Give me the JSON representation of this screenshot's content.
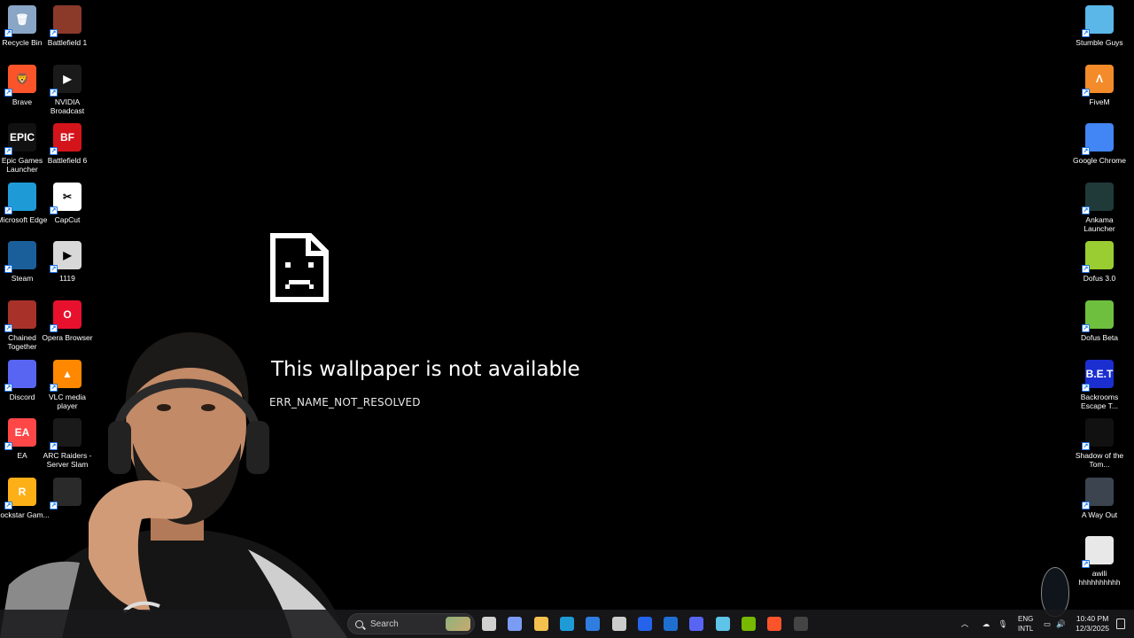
{
  "desktop_left": [
    {
      "label": "Recycle Bin",
      "icon": "recycle-bin-icon",
      "color": "#8aa6c6",
      "glyph": "🗑",
      "col": 0,
      "row": 0
    },
    {
      "label": "Battlefield 1",
      "icon": "battlefield-1-icon",
      "color": "#8b3a2a",
      "glyph": "",
      "col": 1,
      "row": 0
    },
    {
      "label": "Brave",
      "icon": "brave-icon",
      "color": "#fb542b",
      "glyph": "🦁",
      "col": 0,
      "row": 1
    },
    {
      "label": "NVIDIA Broadcast",
      "icon": "nvidia-broadcast-icon",
      "color": "#1a1a1a",
      "glyph": "▶",
      "col": 1,
      "row": 1
    },
    {
      "label": "Epic Games Launcher",
      "icon": "epic-games-icon",
      "color": "#111111",
      "glyph": "EPIC",
      "col": 0,
      "row": 2
    },
    {
      "label": "Battlefield 6",
      "icon": "battlefield-6-icon",
      "color": "#d4141b",
      "glyph": "BF",
      "col": 1,
      "row": 2
    },
    {
      "label": "Microsoft Edge",
      "icon": "edge-icon",
      "color": "#1e9bd7",
      "glyph": "",
      "col": 0,
      "row": 3
    },
    {
      "label": "CapCut",
      "icon": "capcut-icon",
      "color": "#ffffff",
      "glyph": "✂",
      "col": 1,
      "row": 3
    },
    {
      "label": "Steam",
      "icon": "steam-icon",
      "color": "#1b5f9a",
      "glyph": "",
      "col": 0,
      "row": 4
    },
    {
      "label": "1119",
      "icon": "video-file-icon",
      "color": "#d8d8d8",
      "glyph": "▶",
      "col": 1,
      "row": 4
    },
    {
      "label": "Chained Together",
      "icon": "chained-together-icon",
      "color": "#a8322a",
      "glyph": "",
      "col": 0,
      "row": 5
    },
    {
      "label": "Opera Browser",
      "icon": "opera-icon",
      "color": "#e8112d",
      "glyph": "O",
      "col": 1,
      "row": 5
    },
    {
      "label": "Discord",
      "icon": "discord-icon",
      "color": "#5865f2",
      "glyph": "",
      "col": 0,
      "row": 6
    },
    {
      "label": "VLC media player",
      "icon": "vlc-icon",
      "color": "#ff8800",
      "glyph": "▲",
      "col": 1,
      "row": 6
    },
    {
      "label": "EA",
      "icon": "ea-icon",
      "color": "#ff4747",
      "glyph": "EA",
      "col": 0,
      "row": 7
    },
    {
      "label": "ARC Raiders - Server Slam",
      "icon": "arc-raiders-icon",
      "color": "#1a1a1a",
      "glyph": "",
      "col": 1,
      "row": 7
    },
    {
      "label": "Rockstar Gam...",
      "icon": "rockstar-icon",
      "color": "#fcaf17",
      "glyph": "R",
      "col": 0,
      "row": 8
    },
    {
      "label": "",
      "icon": "obs-icon",
      "color": "#2a2a2a",
      "glyph": "",
      "col": 1,
      "row": 8
    }
  ],
  "desktop_right": [
    {
      "label": "Stumble Guys",
      "icon": "stumble-guys-icon",
      "color": "#5ab7e8",
      "glyph": "",
      "row": 0
    },
    {
      "label": "FiveM",
      "icon": "fivem-icon",
      "color": "#f38b2b",
      "glyph": "Λ",
      "row": 1
    },
    {
      "label": "Google Chrome",
      "icon": "chrome-icon",
      "color": "#4285f4",
      "glyph": "",
      "row": 2
    },
    {
      "label": "Ankama Launcher",
      "icon": "ankama-icon",
      "color": "#203a3a",
      "glyph": "",
      "row": 3
    },
    {
      "label": "Dofus 3.0",
      "icon": "dofus-icon",
      "color": "#9acd32",
      "glyph": "",
      "row": 4
    },
    {
      "label": "Dofus Beta",
      "icon": "dofus-beta-icon",
      "color": "#6fbf3f",
      "glyph": "",
      "row": 5
    },
    {
      "label": "Backrooms Escape T...",
      "icon": "backrooms-icon",
      "color": "#1b2fd1",
      "glyph": "B.E.T",
      "row": 6
    },
    {
      "label": "Shadow of the Tom...",
      "icon": "shadow-tomb-raider-icon",
      "color": "#111111",
      "glyph": "",
      "row": 7
    },
    {
      "label": "A Way Out",
      "icon": "a-way-out-icon",
      "color": "#3c4450",
      "glyph": "",
      "row": 8
    },
    {
      "label": "awili hhhhhhhhhh",
      "icon": "text-document-icon",
      "color": "#e8e8e8",
      "glyph": "",
      "row": 9
    }
  ],
  "error": {
    "title": "This wallpaper is not available",
    "code": "ERR_NAME_NOT_RESOLVED"
  },
  "taskbar": {
    "search_placeholder": "Search",
    "apps": [
      {
        "name": "task-view-icon",
        "color": "#d0d0d0"
      },
      {
        "name": "copilot-icon",
        "color": "#7b9cf5"
      },
      {
        "name": "file-explorer-icon",
        "color": "#f2c14e"
      },
      {
        "name": "edge-taskbar-icon",
        "color": "#1e9bd7"
      },
      {
        "name": "store-icon",
        "color": "#2f7de1"
      },
      {
        "name": "unity-icon",
        "color": "#cccccc"
      },
      {
        "name": "app-blue-icon",
        "color": "#2563eb"
      },
      {
        "name": "outlook-icon",
        "color": "#1f6fd1"
      },
      {
        "name": "discord-taskbar-icon",
        "color": "#5865f2"
      },
      {
        "name": "notepad-icon",
        "color": "#5ec4e8"
      },
      {
        "name": "nvidia-taskbar-icon",
        "color": "#76b900"
      },
      {
        "name": "brave-taskbar-icon",
        "color": "#fb542b"
      },
      {
        "name": "obs-taskbar-icon",
        "color": "#444444"
      }
    ],
    "lang_line1": "ENG",
    "lang_line2": "INTL",
    "time": "10:40 PM",
    "date": "12/3/2025"
  }
}
